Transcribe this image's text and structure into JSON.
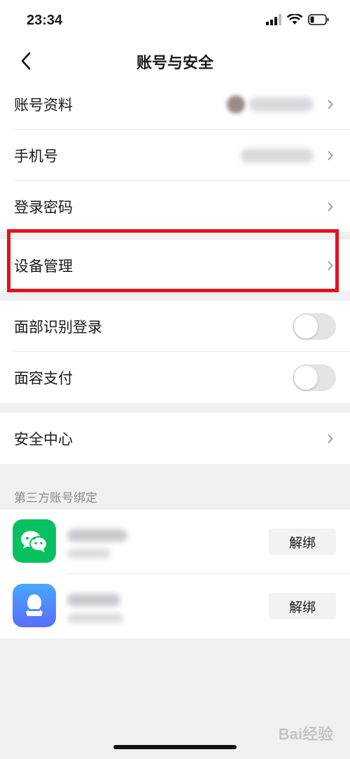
{
  "status": {
    "time": "23:34"
  },
  "nav": {
    "title": "账号与安全"
  },
  "group1": [
    {
      "label": "账号资料"
    },
    {
      "label": "手机号"
    },
    {
      "label": "登录密码"
    }
  ],
  "device": {
    "label": "设备管理"
  },
  "group2": [
    {
      "label": "面部识别登录",
      "toggle_on": false
    },
    {
      "label": "面容支付",
      "toggle_on": false
    }
  ],
  "security": {
    "label": "安全中心"
  },
  "third_party": {
    "header": "第三方账号绑定",
    "accounts": [
      {
        "icon": "wechat-icon",
        "color": "#07c160",
        "button": "解绑"
      },
      {
        "icon": "qq-icon",
        "color": "#3d8bfa",
        "button": "解绑"
      }
    ]
  },
  "watermark": "Bai经验",
  "colors": {
    "highlight": "#e3131b",
    "background": "#f0f0f2"
  }
}
